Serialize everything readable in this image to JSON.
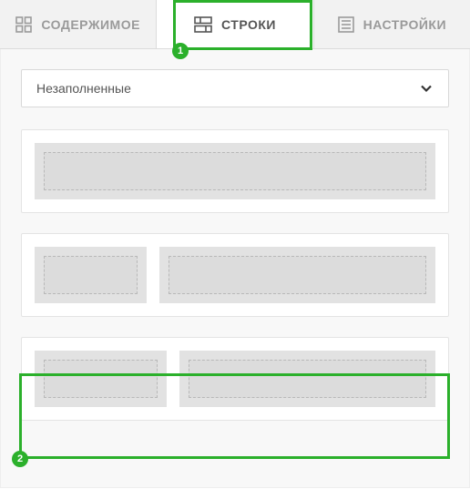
{
  "tabs": {
    "content": "СОДЕРЖИМОЕ",
    "rows": "СТРОКИ",
    "settings": "НАСТРОЙКИ"
  },
  "dropdown": {
    "selected": "Незаполненные"
  },
  "annotations": {
    "badge1": "1",
    "badge2": "2"
  },
  "colors": {
    "highlight": "#2bb02b"
  }
}
